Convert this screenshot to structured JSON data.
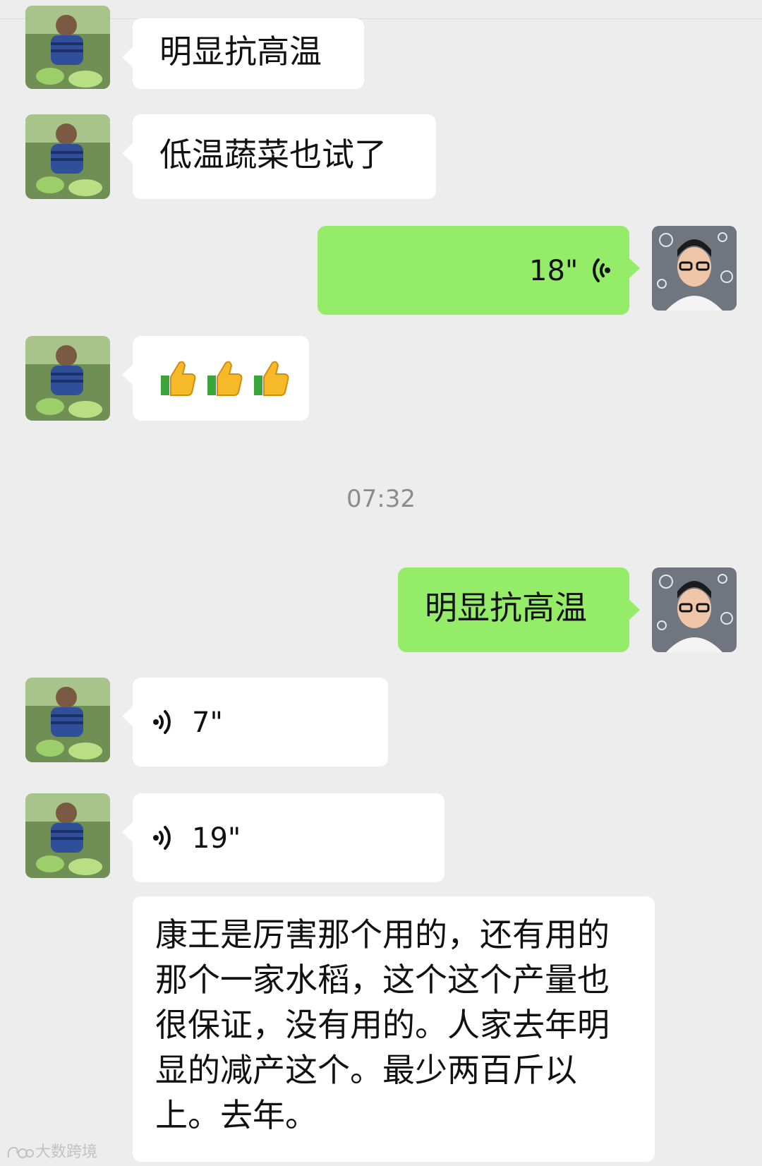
{
  "chat": {
    "messages": [
      {
        "id": "m1",
        "side": "in",
        "type": "text",
        "text": "明显抗高温"
      },
      {
        "id": "m2",
        "side": "in",
        "type": "text",
        "text": "低温蔬菜也试了"
      },
      {
        "id": "m3",
        "side": "out",
        "type": "voice",
        "duration": "18\""
      },
      {
        "id": "m4",
        "side": "in",
        "type": "emoji",
        "emoji_name": "thumbs-up-icon",
        "count": 3
      },
      {
        "id": "m5",
        "side": "out",
        "type": "text",
        "text": "明显抗高温"
      },
      {
        "id": "m6",
        "side": "in",
        "type": "voice",
        "duration": "7\""
      },
      {
        "id": "m7",
        "side": "in",
        "type": "voice",
        "duration": "19\""
      },
      {
        "id": "m8",
        "side": "in",
        "type": "text",
        "text": "康王是厉害那个用的，还有用的那个一家水稻，这个这个产量也很保证，没有用的。人家去年明显的减产这个。最少两百斤以上。去年。"
      }
    ],
    "timestamp": "07:32"
  },
  "watermark": {
    "text": "大数跨境"
  },
  "colors": {
    "background": "#ededed",
    "incoming_bubble": "#ffffff",
    "outgoing_bubble": "#95ec69",
    "timestamp_text": "#8c8c8c"
  },
  "icons": {
    "voice": "voice-wave-icon",
    "thumbs": "thumbs-up-icon"
  }
}
